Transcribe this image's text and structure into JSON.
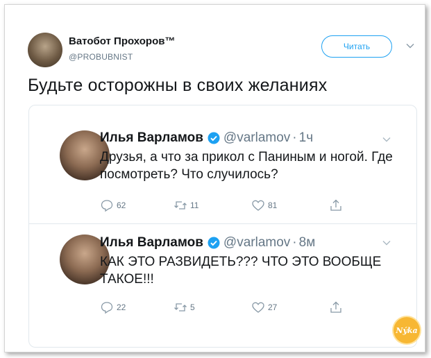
{
  "main_tweet": {
    "author_name": "Ватобот Прохоров™",
    "handle": "@PROBUBNIST",
    "follow_label": "Читать",
    "text": "Будьте осторожны в своих желаниях"
  },
  "replies": [
    {
      "name": "Илья Варламов",
      "handle": "@varlamov",
      "separator": "·",
      "time": "1ч",
      "text": "Друзья, а что за прикол с Паниным и ногой. Где посмотреть? Что случилось?",
      "reply_count": "62",
      "retweet_count": "11",
      "like_count": "81"
    },
    {
      "name": "Илья Варламов",
      "handle": "@varlamov",
      "separator": "·",
      "time": "8м",
      "text": "КАК ЭТО РАЗВИДЕТЬ??? ЧТО ЭТО ВООБЩЕ ТАКОЕ!!!",
      "reply_count": "22",
      "retweet_count": "5",
      "like_count": "27"
    }
  ],
  "watermark": {
    "text": "Nýka"
  },
  "colors": {
    "accent": "#1da1f2",
    "muted": "#657786",
    "text": "#14171a",
    "border": "#e1e8ed",
    "watermark": "#f7b733"
  },
  "icons": [
    "chevron-down-icon",
    "verified-icon",
    "reply-icon",
    "retweet-icon",
    "like-icon",
    "share-icon"
  ]
}
